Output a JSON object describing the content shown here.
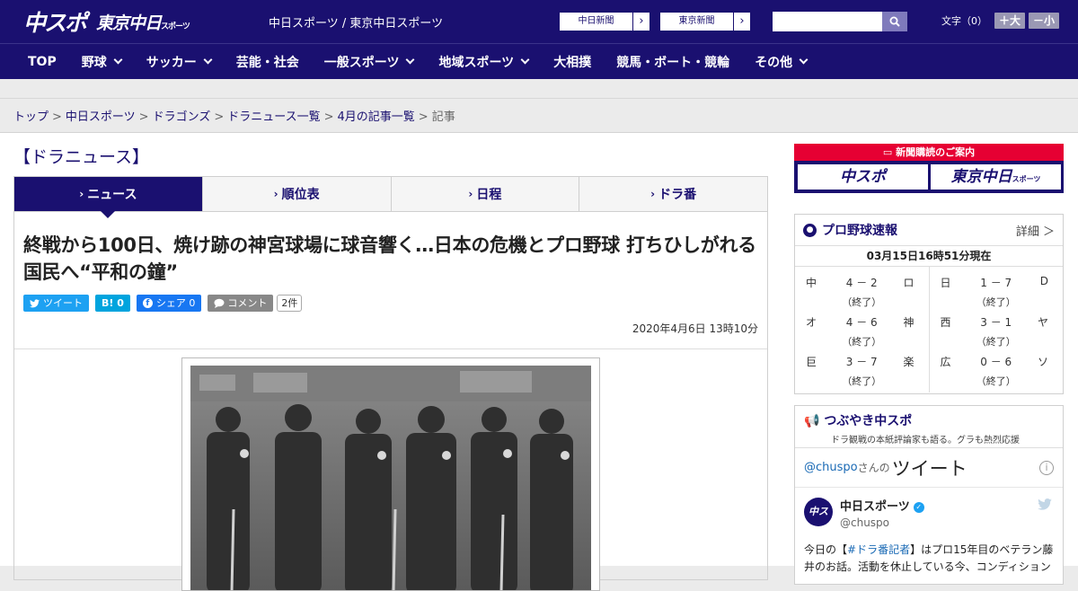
{
  "header": {
    "logo_main": "中スポ",
    "logo_sub": "東京中日",
    "logo_sub_small": "スポーツ",
    "site_name": "中日スポーツ / 東京中日スポーツ",
    "paper_links": [
      {
        "label": "中日新聞",
        "arrow": "›"
      },
      {
        "label": "東京新聞",
        "arrow": "›"
      }
    ],
    "search": {
      "placeholder": "",
      "value": ""
    },
    "font_size": {
      "label": "文字（0）",
      "larger": "＋大",
      "smaller": "－小"
    }
  },
  "nav": {
    "items": [
      {
        "label": "TOP",
        "dropdown": false
      },
      {
        "label": "野球",
        "dropdown": true
      },
      {
        "label": "サッカー",
        "dropdown": true
      },
      {
        "label": "芸能・社会",
        "dropdown": false
      },
      {
        "label": "一般スポーツ",
        "dropdown": true
      },
      {
        "label": "地域スポーツ",
        "dropdown": true
      },
      {
        "label": "大相撲",
        "dropdown": false
      },
      {
        "label": "競馬・ボート・競輪",
        "dropdown": false
      },
      {
        "label": "その他",
        "dropdown": true
      }
    ]
  },
  "breadcrumb": {
    "items": [
      "トップ",
      "中日スポーツ",
      "ドラゴンズ",
      "ドラニュース一覧",
      "4月の記事一覧"
    ],
    "current": "記事",
    "separator": ">"
  },
  "section": {
    "title": "【ドラニュース】",
    "tabs": [
      "ニュース",
      "順位表",
      "日程",
      "ドラ番"
    ],
    "active_tab": 0
  },
  "article": {
    "headline": "終戦から100日、焼け跡の神宮球場に球音響く…日本の危機とプロ野球 打ちひしがれる国民へ“平和の鐘”",
    "share": {
      "tweet": "ツイート",
      "hatena": "B! 0",
      "facebook": "シェア 0",
      "comment": "コメント",
      "comment_count": "2件"
    },
    "date": "2020年4月6日 13時10分"
  },
  "sidebar": {
    "subscription": {
      "header": "新聞購読のご案内",
      "buttons": [
        "中スポ",
        "東京中日"
      ],
      "button2_small": "スポーツ"
    },
    "scores": {
      "title": "プロ野球速報",
      "more": "詳細 ＞",
      "as_of": "03月15日16時51分現在",
      "games": [
        {
          "away": "中",
          "score": "4 － 2",
          "home": "ロ",
          "status": "（終了）"
        },
        {
          "away": "オ",
          "score": "4 － 6",
          "home": "神",
          "status": "（終了）"
        },
        {
          "away": "巨",
          "score": "3 － 7",
          "home": "楽",
          "status": "（終了）"
        },
        {
          "away": "日",
          "score": "1 － 7",
          "home": "D",
          "status": "（終了）"
        },
        {
          "away": "西",
          "score": "3 － 1",
          "home": "ヤ",
          "status": "（終了）"
        },
        {
          "away": "広",
          "score": "0 － 6",
          "home": "ソ",
          "status": "（終了）"
        }
      ]
    },
    "tweets": {
      "title": "つぶやき中スポ",
      "subtitle": "ドラ観戦の本紙評論家も語る。グラも熱烈応援",
      "handle_link": "@chuspo",
      "san": "さんの",
      "heading": "ツイート",
      "info": "i",
      "tweet": {
        "avatar": "中スポ",
        "name": "中日スポーツ",
        "handle": "@chuspo",
        "text_before": "今日の【",
        "hashtag": "#ドラ番記者",
        "text_after": "】はプロ15年目のベテラン藤井のお話。活動を休止している今、コンディション"
      }
    }
  },
  "colors": {
    "brand": "#1a1070",
    "accent": "#e60033",
    "twitter": "#1da1f2",
    "facebook": "#1877f2"
  }
}
